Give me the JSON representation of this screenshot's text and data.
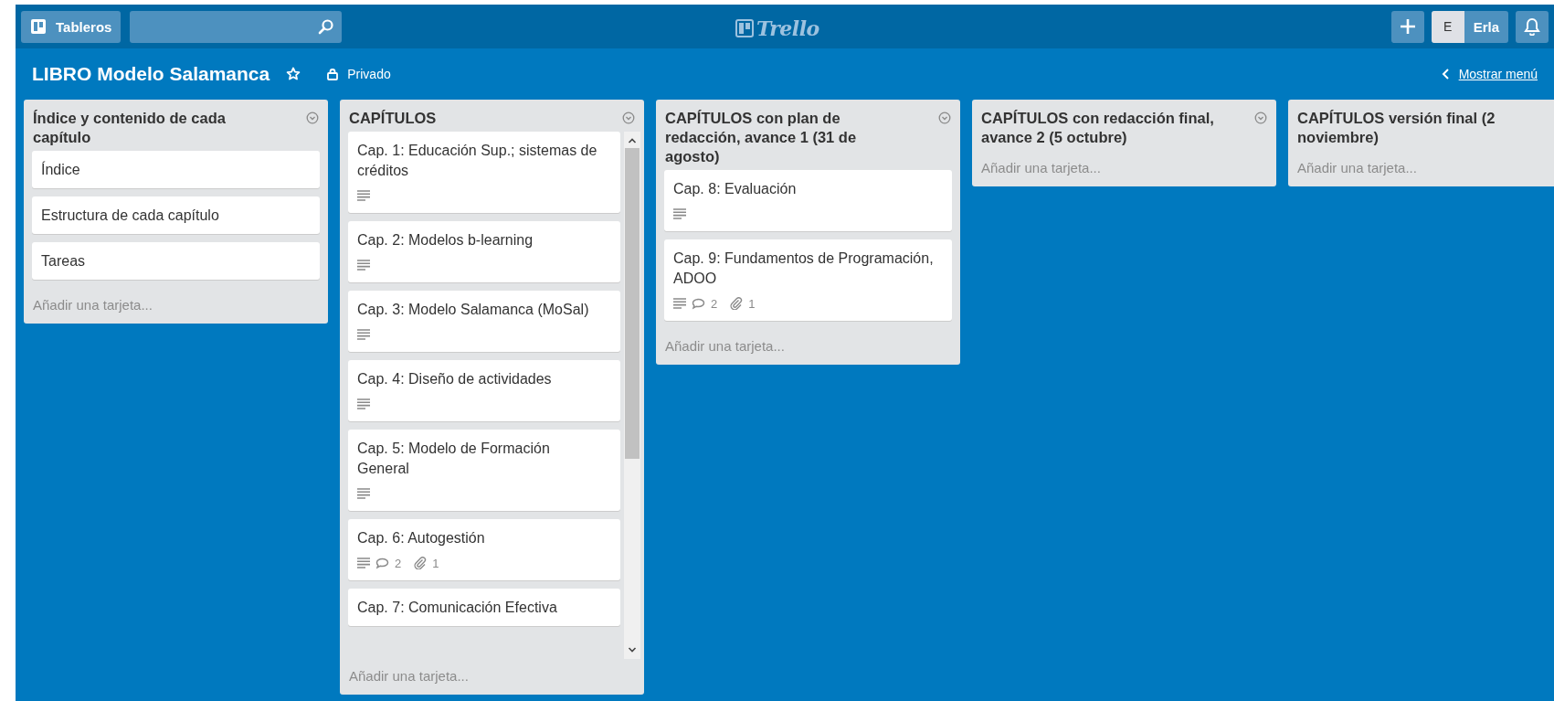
{
  "header": {
    "boards_button": "Tableros",
    "logo": "Trello",
    "user_initial": "E",
    "user_name": "Erla"
  },
  "board": {
    "title": "LIBRO Modelo Salamanca",
    "starred": false,
    "visibility": "Privado",
    "menu_link": "Mostrar menú"
  },
  "lists": [
    {
      "title": "Índice y contenido de cada capítulo",
      "scrollable": false,
      "add_card": "Añadir una tarjeta...",
      "cards": [
        {
          "title": "Índice",
          "description": false
        },
        {
          "title": "Estructura de cada capítulo",
          "description": false
        },
        {
          "title": "Tareas",
          "description": false
        }
      ]
    },
    {
      "title": "CAPÍTULOS",
      "scrollable": true,
      "add_card": "Añadir una tarjeta...",
      "cards": [
        {
          "title": "Cap. 1: Educación Sup.; sistemas de créditos",
          "description": true
        },
        {
          "title": "Cap. 2: Modelos b-learning",
          "description": true
        },
        {
          "title": "Cap. 3: Modelo Salamanca (MoSal)",
          "description": true
        },
        {
          "title": "Cap. 4: Diseño de actividades",
          "description": true
        },
        {
          "title": "Cap. 5: Modelo de Formación General",
          "description": true
        },
        {
          "title": "Cap. 6: Autogestión",
          "description": true,
          "comments": "2",
          "attachments": "1"
        },
        {
          "title": "Cap. 7: Comunicación Efectiva",
          "description": false
        }
      ]
    },
    {
      "title": "CAPÍTULOS con plan de redacción, avance 1 (31 de agosto)",
      "scrollable": false,
      "add_card": "Añadir una tarjeta...",
      "cards": [
        {
          "title": "Cap. 8: Evaluación",
          "description": true
        },
        {
          "title": "Cap. 9: Fundamentos de Programación, ADOO",
          "description": true,
          "comments": "2",
          "attachments": "1"
        }
      ]
    },
    {
      "title": "CAPÍTULOS con redacción final, avance 2 (5 octubre)",
      "scrollable": false,
      "add_card": "Añadir una tarjeta..."
    },
    {
      "title": "CAPÍTULOS versión final (2 noviembre)",
      "scrollable": false,
      "add_card": "Añadir una tarjeta..."
    }
  ]
}
